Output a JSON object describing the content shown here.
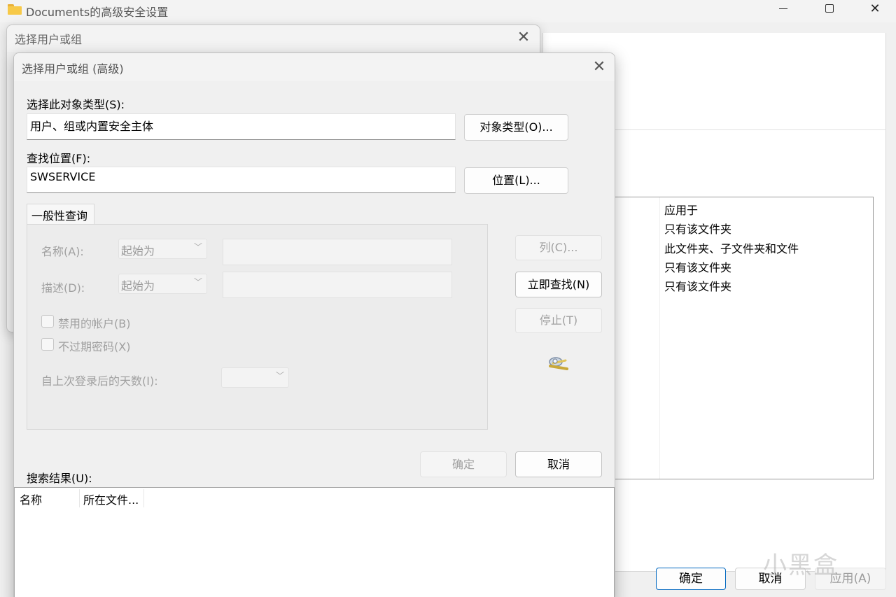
{
  "background_window": {
    "title": "Documents的高级安全设置",
    "list_header": "应用于",
    "list_items": [
      "只有该文件夹",
      "此文件夹、子文件夹和文件",
      "只有该文件夹",
      "只有该文件夹"
    ],
    "buttons": {
      "ok": "确定",
      "cancel": "取消",
      "apply": "应用(A)"
    }
  },
  "middle_dialog": {
    "title": "选择用户或组",
    "close": "✕"
  },
  "dialog": {
    "title": "选择用户或组 (高级)",
    "close": "✕",
    "object_type_label": "选择此对象类型(S):",
    "object_type_value": "用户、组或内置安全主体",
    "object_types_button": "对象类型(O)...",
    "location_label": "查找位置(F):",
    "location_value": "SWSERVICE",
    "locations_button": "位置(L)...",
    "general_query": {
      "tab_label": "一般性查询",
      "name_label": "名称(A):",
      "name_match": "起始为",
      "description_label": "描述(D):",
      "description_match": "起始为",
      "disabled_accounts_label": "禁用的帐户(B)",
      "non_expiring_password_label": "不过期密码(X)",
      "days_since_logon_label": "自上次登录后的天数(I):"
    },
    "columns_button": "列(C)...",
    "find_now_button": "立即查找(N)",
    "stop_button": "停止(T)",
    "ok_button": "确定",
    "cancel_button": "取消",
    "results_label": "搜索结果(U):",
    "results_columns": [
      "名称",
      "所在文件..."
    ]
  },
  "watermark": "小黑盒"
}
